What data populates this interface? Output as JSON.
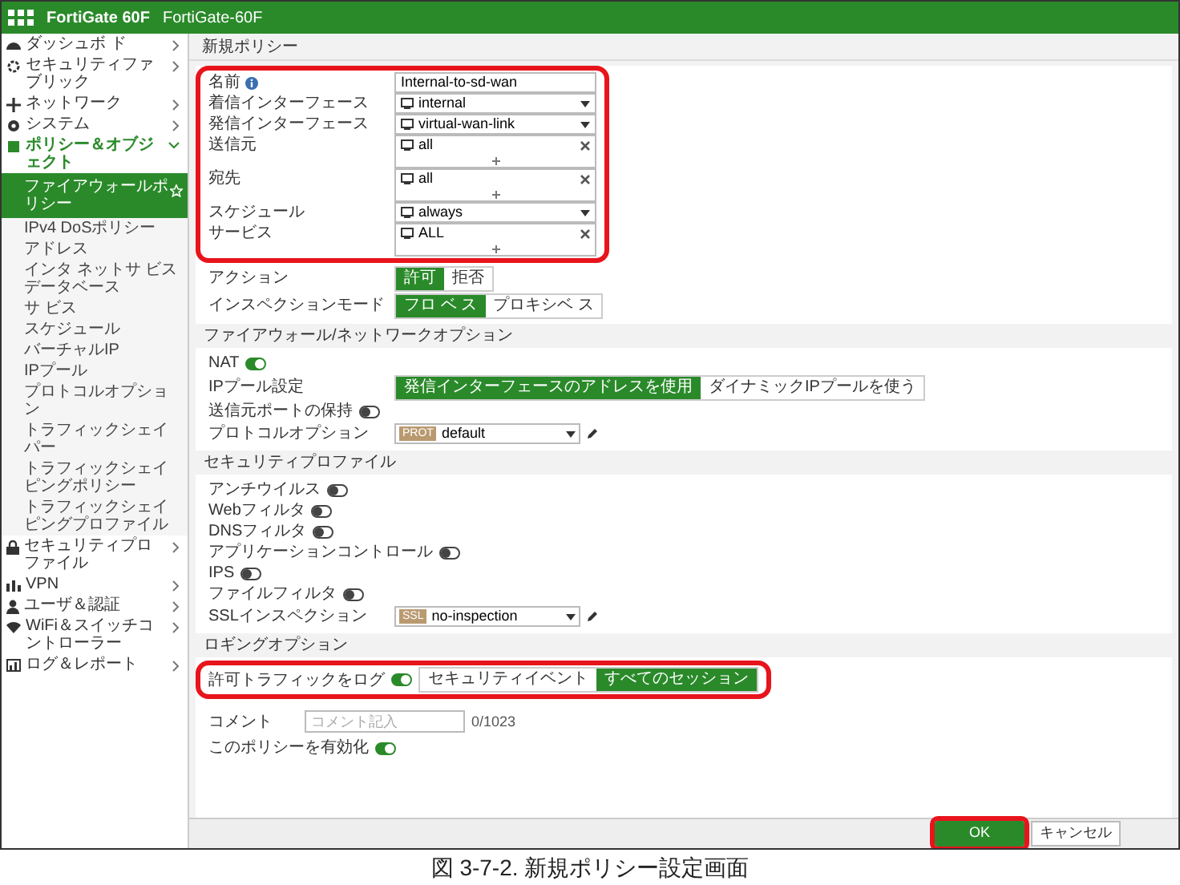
{
  "header": {
    "product": "FortiGate 60F",
    "hostname": "FortiGate-60F"
  },
  "sidebar": [
    {
      "label": "ダッシュボ ド",
      "expanded": false
    },
    {
      "label": "セキュリティファブリック",
      "expanded": false
    },
    {
      "label": "ネットワーク",
      "expanded": false
    },
    {
      "label": "システム",
      "expanded": false
    },
    {
      "label": "ポリシー＆オブジェクト",
      "expanded": true,
      "children": [
        {
          "label": "ファイアウォールポリシー",
          "selected": true
        },
        {
          "label": "IPv4 DoSポリシー",
          "selected": false
        },
        {
          "label": "アドレス",
          "selected": false
        },
        {
          "label": "インタ ネットサ ビスデータベース",
          "selected": false
        },
        {
          "label": "サ ビス",
          "selected": false
        },
        {
          "label": "スケジュール",
          "selected": false
        },
        {
          "label": "バーチャルIP",
          "selected": false
        },
        {
          "label": "IPプール",
          "selected": false
        },
        {
          "label": "プロトコルオプション",
          "selected": false
        },
        {
          "label": "トラフィックシェイパー",
          "selected": false
        },
        {
          "label": "トラフィックシェイピングポリシー",
          "selected": false
        },
        {
          "label": "トラフィックシェイピングプロファイル",
          "selected": false
        }
      ]
    },
    {
      "label": "セキュリティプロファイル",
      "expanded": false
    },
    {
      "label": "VPN",
      "expanded": false
    },
    {
      "label": "ユーザ＆認証",
      "expanded": false
    },
    {
      "label": "WiFi＆スイッチコントローラー",
      "expanded": false
    },
    {
      "label": "ログ＆レポート",
      "expanded": false
    }
  ],
  "main": {
    "title": "新規ポリシー",
    "blocks": [
      {
        "kind": "group",
        "highlighted": true,
        "rows": [
          {
            "kind": "text",
            "label": "名前",
            "info": true,
            "value": "Internal-to-sd-wan"
          },
          {
            "kind": "select",
            "label": "着信インターフェース",
            "value": "internal"
          },
          {
            "kind": "select",
            "label": "発信インターフェース",
            "value": "virtual-wan-link"
          },
          {
            "kind": "multi",
            "label": "送信元",
            "value": "all"
          },
          {
            "kind": "multi",
            "label": "宛先",
            "value": "all"
          },
          {
            "kind": "select",
            "label": "スケジュール",
            "value": "always"
          },
          {
            "kind": "multi",
            "label": "サービス",
            "value": "ALL"
          }
        ]
      },
      {
        "kind": "group",
        "rows": [
          {
            "kind": "segmented",
            "label": "アクション",
            "options": [
              {
                "text": "許可",
                "selected": true
              },
              {
                "text": "拒否",
                "selected": false
              }
            ]
          },
          {
            "kind": "segmented",
            "label": "インスペクションモード",
            "options": [
              {
                "text": "フロ ベ ス",
                "selected": true
              },
              {
                "text": "プロキシベ ス",
                "selected": false
              }
            ]
          }
        ]
      },
      {
        "kind": "heading",
        "text": "ファイアウォール/ネットワークオプション"
      },
      {
        "kind": "group",
        "rows": [
          {
            "kind": "toggle",
            "label": "NAT",
            "on": true
          },
          {
            "kind": "segmented",
            "label": "IPプール設定",
            "options": [
              {
                "text": "発信インターフェースのアドレスを使用",
                "selected": true
              },
              {
                "text": "ダイナミックIPプールを使う",
                "selected": false
              }
            ]
          },
          {
            "kind": "toggle",
            "label": "送信元ポートの保持",
            "on": false
          },
          {
            "kind": "profile",
            "label": "プロトコルオプション",
            "badge": "PROT",
            "value": "default"
          }
        ]
      },
      {
        "kind": "heading",
        "text": "セキュリティプロファイル"
      },
      {
        "kind": "group",
        "rows": [
          {
            "kind": "toggle",
            "label": "アンチウイルス",
            "on": false
          },
          {
            "kind": "toggle",
            "label": "Webフィルタ",
            "on": false
          },
          {
            "kind": "toggle",
            "label": "DNSフィルタ",
            "on": false
          },
          {
            "kind": "toggle",
            "label": "アプリケーションコントロール",
            "on": false
          },
          {
            "kind": "toggle",
            "label": "IPS",
            "on": false
          },
          {
            "kind": "toggle",
            "label": "ファイルフィルタ",
            "on": false
          },
          {
            "kind": "profile",
            "label": "SSLインスペクション",
            "badge": "SSL",
            "value": "no-inspection"
          }
        ]
      },
      {
        "kind": "heading",
        "text": "ロギングオプション"
      },
      {
        "kind": "group",
        "highlighted": true,
        "rows": [
          {
            "kind": "toggle_segmented",
            "label": "許可トラフィックをログ",
            "on": true,
            "options": [
              {
                "text": "セキュリティイベント",
                "selected": false
              },
              {
                "text": "すべてのセッション",
                "selected": true
              }
            ]
          }
        ]
      },
      {
        "kind": "group",
        "rows": [
          {
            "kind": "comment",
            "label": "コメント",
            "placeholder": "コメント記入",
            "counter": "0/1023"
          },
          {
            "kind": "toggle",
            "label": "このポリシーを有効化",
            "on": true
          }
        ]
      }
    ],
    "buttons": [
      {
        "text": "OK",
        "primary": true,
        "highlighted": true
      },
      {
        "text": "キャンセル",
        "primary": false
      }
    ]
  },
  "caption": "図 3-7-2. 新規ポリシー設定画面"
}
